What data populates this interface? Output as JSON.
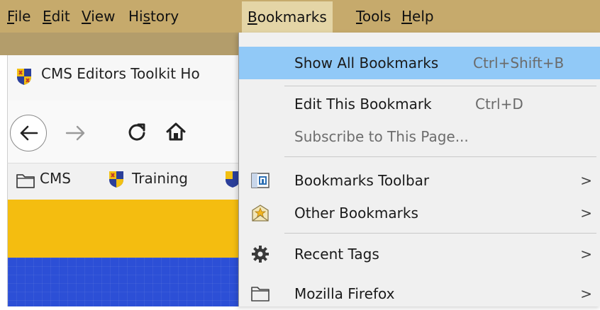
{
  "menubar": {
    "items": [
      {
        "mnemonic": "F",
        "rest": "ile"
      },
      {
        "mnemonic": "E",
        "rest": "dit"
      },
      {
        "mnemonic": "V",
        "rest": "iew"
      },
      {
        "pre": "Hi",
        "mnemonic": "s",
        "rest": "tory"
      },
      {
        "mnemonic": "B",
        "rest": "ookmarks"
      },
      {
        "mnemonic": "T",
        "rest": "ools"
      },
      {
        "mnemonic": "H",
        "rest": "elp"
      }
    ],
    "open_item": "Bookmarks"
  },
  "tab": {
    "title": "CMS Editors Toolkit Ho"
  },
  "bookmarks_toolbar": {
    "items": [
      {
        "label": "CMS",
        "icon": "folder-icon"
      },
      {
        "label": "Training",
        "icon": "crest-icon"
      }
    ]
  },
  "dropdown": {
    "items": [
      {
        "label": "Show All Bookmarks",
        "shortcut": "Ctrl+Shift+B",
        "highlighted": true
      },
      {
        "label": "Edit This Bookmark",
        "shortcut": "Ctrl+D"
      },
      {
        "label": "Subscribe to This Page...",
        "disabled": true
      },
      {
        "label": "Bookmarks Toolbar",
        "icon": "bookmarks-toolbar-icon",
        "submenu": true
      },
      {
        "label": "Other Bookmarks",
        "icon": "other-bookmarks-icon",
        "submenu": true
      },
      {
        "label": "Recent Tags",
        "icon": "gear-icon",
        "submenu": true
      },
      {
        "label": "Mozilla Firefox",
        "icon": "folder-icon",
        "submenu": true
      }
    ],
    "submenu_glyph": ">"
  },
  "colors": {
    "menubar": "#c6aa6c",
    "highlight": "#91c9f7",
    "yellow_band": "#f4bd10",
    "blue_band": "#2c4fd6"
  }
}
